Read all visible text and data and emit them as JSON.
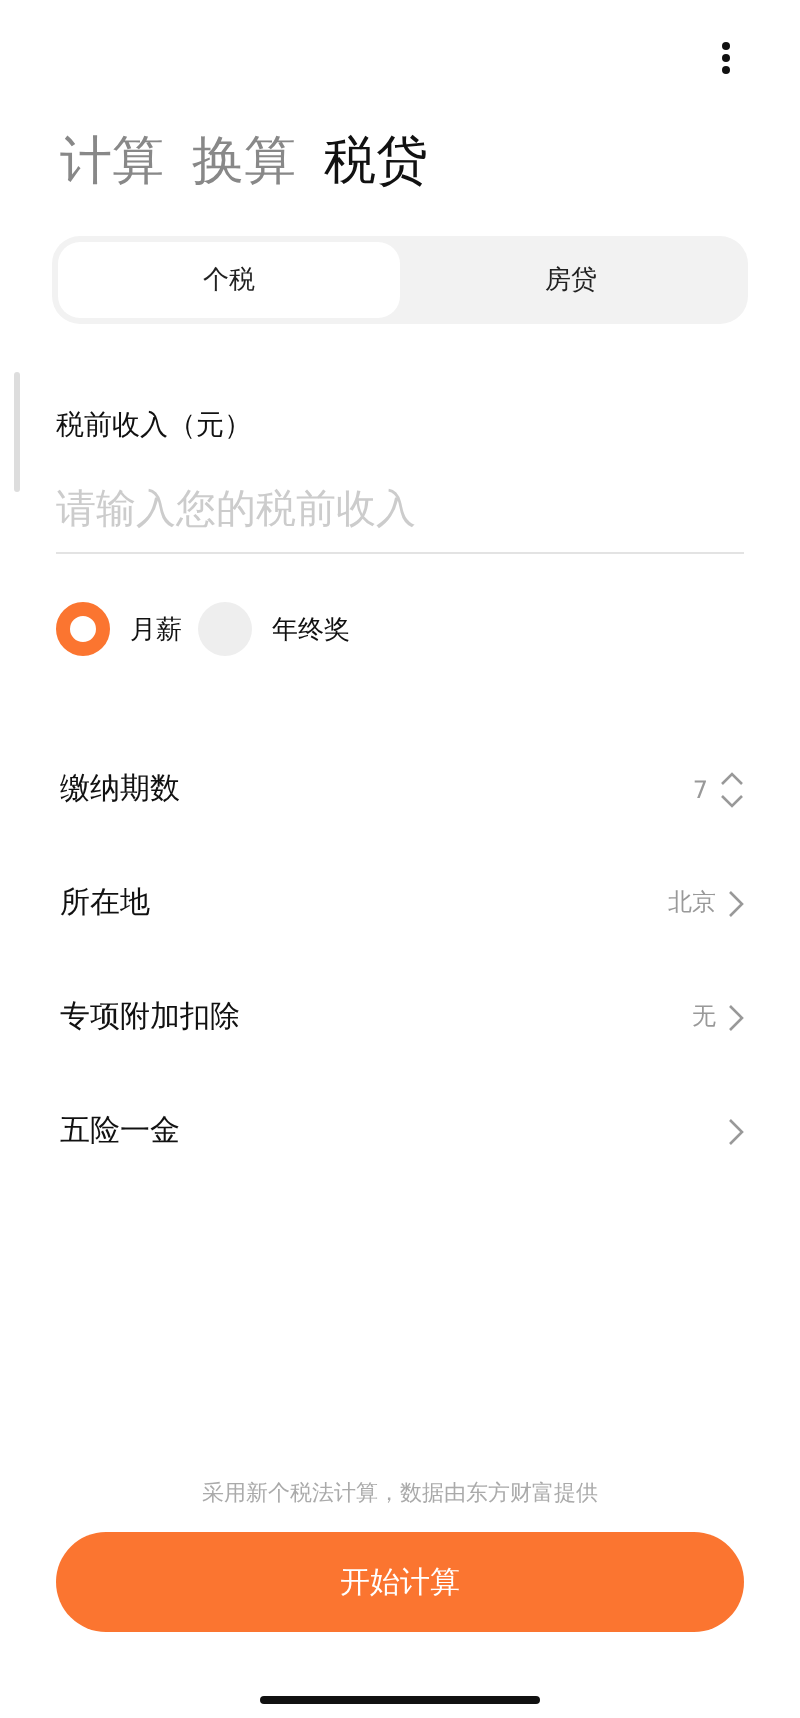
{
  "header_tabs": [
    {
      "label": "计算",
      "selected": false
    },
    {
      "label": "换算",
      "selected": false
    },
    {
      "label": "税贷",
      "selected": true
    }
  ],
  "segments": [
    {
      "label": "个税",
      "selected": true
    },
    {
      "label": "房贷",
      "selected": false
    }
  ],
  "income": {
    "label": "税前收入（元）",
    "placeholder": "请输入您的税前收入"
  },
  "pay_types": [
    {
      "label": "月薪",
      "selected": true
    },
    {
      "label": "年终奖",
      "selected": false
    }
  ],
  "rows": [
    {
      "kind": "stepper",
      "label": "缴纳期数",
      "value": "7"
    },
    {
      "kind": "link",
      "label": "所在地",
      "value": "北京"
    },
    {
      "kind": "link",
      "label": "专项附加扣除",
      "value": "无"
    },
    {
      "kind": "link",
      "label": "五险一金"
    }
  ],
  "note": "采用新个税法计算，数据由东方财富提供",
  "submit": "开始计算"
}
